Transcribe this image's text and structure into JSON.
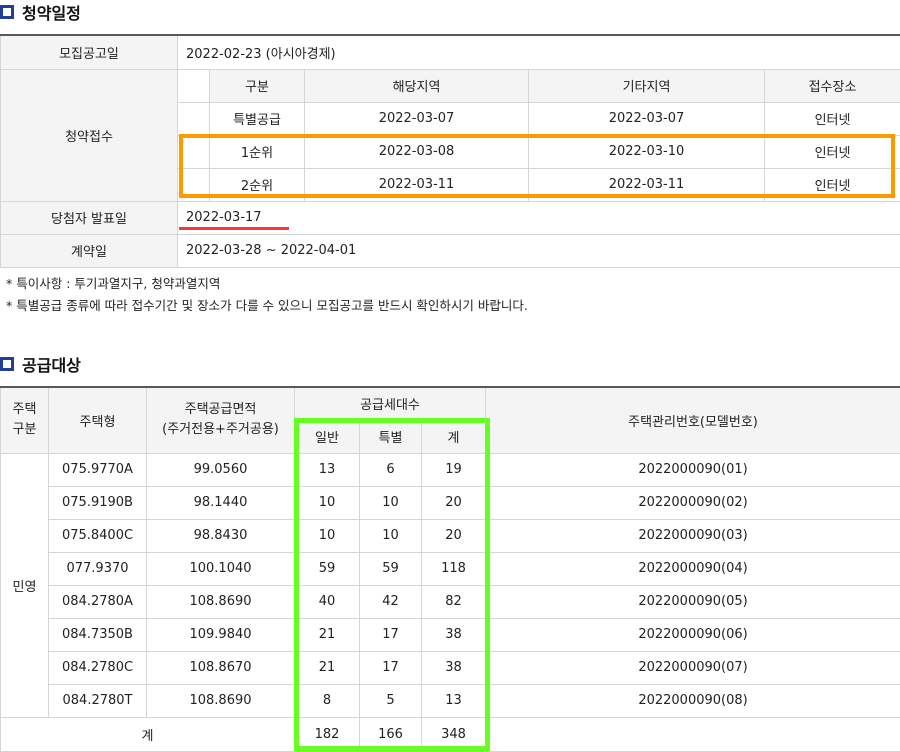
{
  "schedule": {
    "title": "청약일정",
    "notice_label": "모집공고일",
    "notice_value": "2022-02-23 (아시아경제)",
    "reception_label": "청약접수",
    "reception_headers": [
      "구분",
      "해당지역",
      "기타지역",
      "접수장소"
    ],
    "reception_rows": [
      [
        "특별공급",
        "2022-03-07",
        "2022-03-07",
        "인터넷"
      ],
      [
        "1순위",
        "2022-03-08",
        "2022-03-10",
        "인터넷"
      ],
      [
        "2순위",
        "2022-03-11",
        "2022-03-11",
        "인터넷"
      ]
    ],
    "winner_label": "당첨자 발표일",
    "winner_value": "2022-03-17",
    "contract_label": "계약일",
    "contract_value": "2022-03-28 ~ 2022-04-01"
  },
  "notes": [
    "* 특이사항 : 투기과열지구, 청약과열지역",
    "* 특별공급 종류에 따라 접수기간 및 장소가 다를 수 있으니 모집공고를 반드시 확인하시기 바랍니다."
  ],
  "supply": {
    "title": "공급대상",
    "headers": {
      "type_group": "주택\n구분",
      "housing_type": "주택형",
      "area": "주택공급면적\n(주거전용+주거공용)",
      "units": "공급세대수",
      "general": "일반",
      "special": "특별",
      "total": "계",
      "model_no": "주택관리번호(모델번호)"
    },
    "group_label": "민영",
    "rows": [
      [
        "075.9770A",
        "99.0560",
        "13",
        "6",
        "19",
        "2022000090(01)"
      ],
      [
        "075.9190B",
        "98.1440",
        "10",
        "10",
        "20",
        "2022000090(02)"
      ],
      [
        "075.8400C",
        "98.8430",
        "10",
        "10",
        "20",
        "2022000090(03)"
      ],
      [
        "077.9370",
        "100.1040",
        "59",
        "59",
        "118",
        "2022000090(04)"
      ],
      [
        "084.2780A",
        "108.8690",
        "40",
        "42",
        "82",
        "2022000090(05)"
      ],
      [
        "084.7350B",
        "109.9840",
        "21",
        "17",
        "38",
        "2022000090(06)"
      ],
      [
        "084.2780C",
        "108.8670",
        "21",
        "17",
        "38",
        "2022000090(07)"
      ],
      [
        "084.2780T",
        "108.8690",
        "8",
        "5",
        "13",
        "2022000090(08)"
      ]
    ],
    "total_label": "계",
    "total_general": "182",
    "total_special": "166",
    "total_total": "348"
  },
  "colors": {
    "title_icon": "#1f3f9a",
    "highlight_orange": "#ff9900",
    "highlight_green": "#66ff22",
    "underline_red": "#ff3333"
  }
}
